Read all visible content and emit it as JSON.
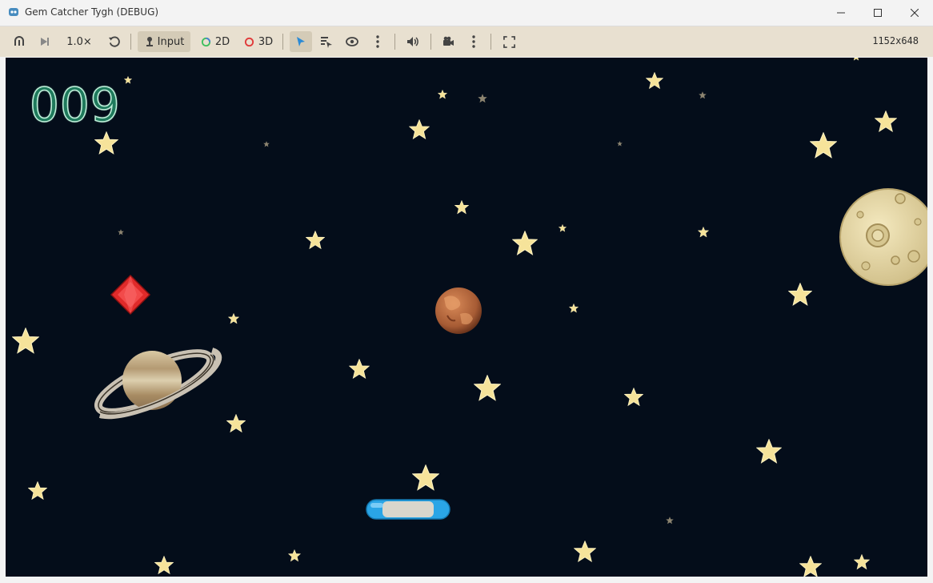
{
  "window": {
    "title": "Gem Catcher Tygh (DEBUG)"
  },
  "toolbar": {
    "speed_label": "1.0×",
    "input_label": "Input",
    "twod_label": "2D",
    "threed_label": "3D",
    "resolution_label": "1152x648"
  },
  "game": {
    "score": "009"
  },
  "colors": {
    "viewport_bg": "#040d1a",
    "star": "#f6e39a",
    "score": "#1f7a5c",
    "gem": "#e02a2a",
    "paddle": "#2aa5e6"
  }
}
